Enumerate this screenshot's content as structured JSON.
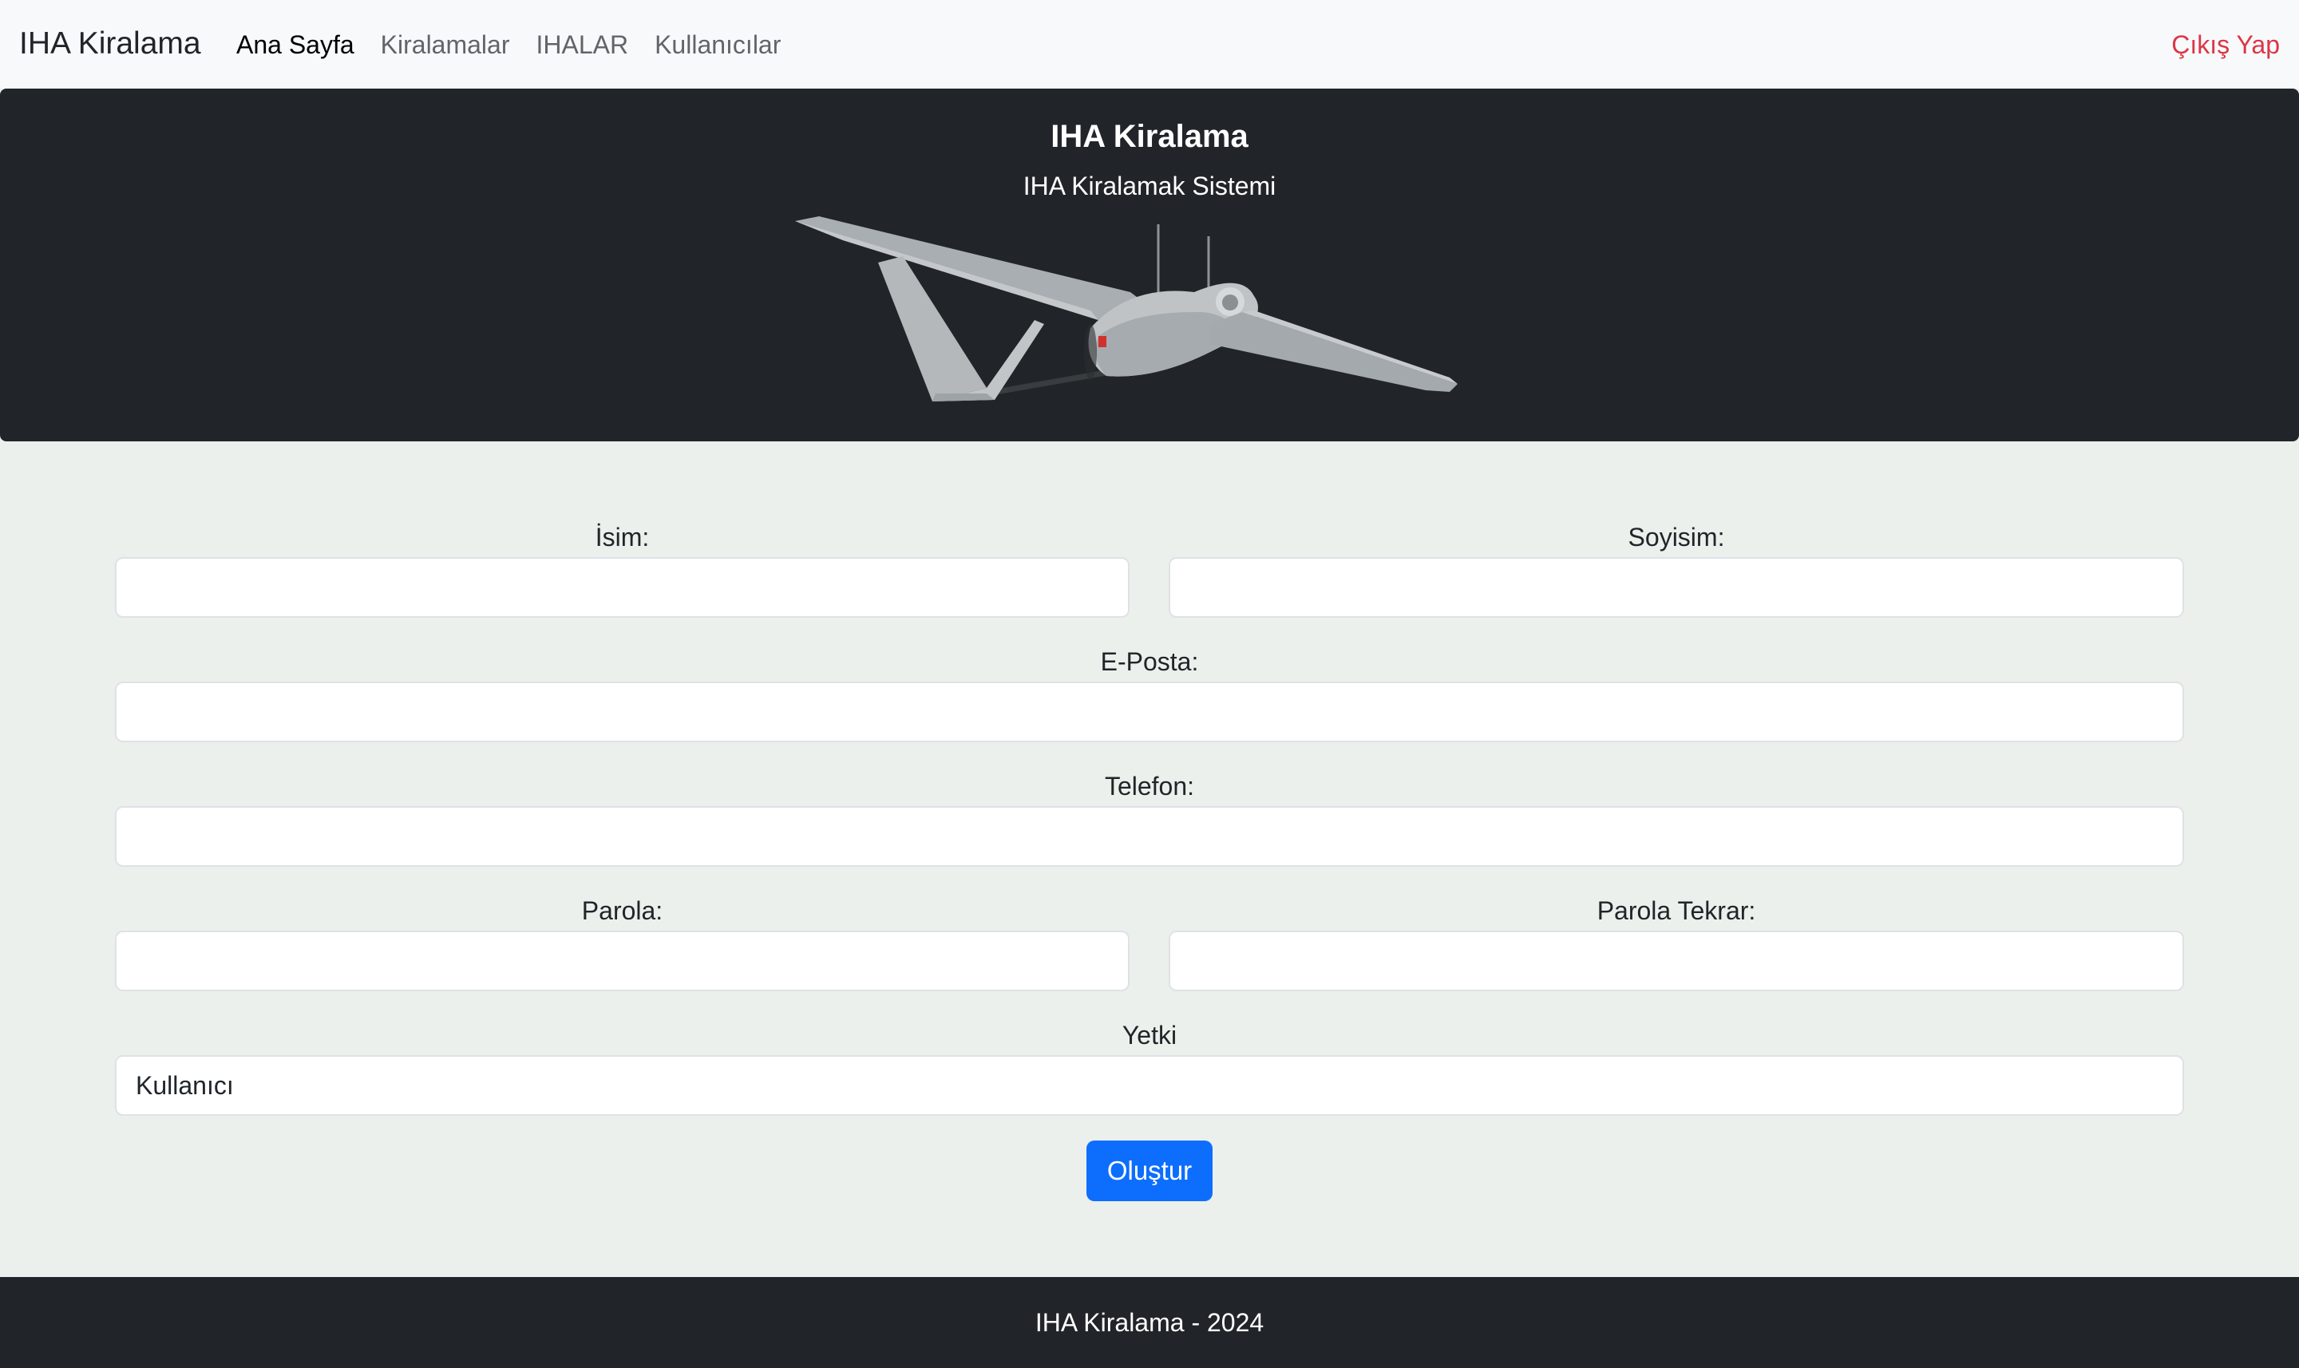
{
  "navbar": {
    "brand": "IHA Kiralama",
    "links": [
      "Ana Sayfa",
      "Kiralamalar",
      "IHALAR",
      "Kullanıcılar"
    ],
    "logout": "Çıkış Yap"
  },
  "hero": {
    "title": "IHA Kiralama",
    "subtitle": "IHA Kiralamak Sistemi",
    "image": "drone-image"
  },
  "form": {
    "first_name_label": "İsim:",
    "last_name_label": "Soyisim:",
    "email_label": "E-Posta:",
    "phone_label": "Telefon:",
    "password_label": "Parola:",
    "password_repeat_label": "Parola Tekrar:",
    "role_label": "Yetki",
    "role_value": "Kullanıcı",
    "submit_label": "Oluştur"
  },
  "footer": {
    "text": "IHA Kiralama - 2024"
  },
  "colors": {
    "navbar_bg": "#f8f9fa",
    "hero_bg": "#212529",
    "page_bg": "#ebf0ec",
    "primary": "#0d6efd",
    "danger": "#dc3545"
  }
}
